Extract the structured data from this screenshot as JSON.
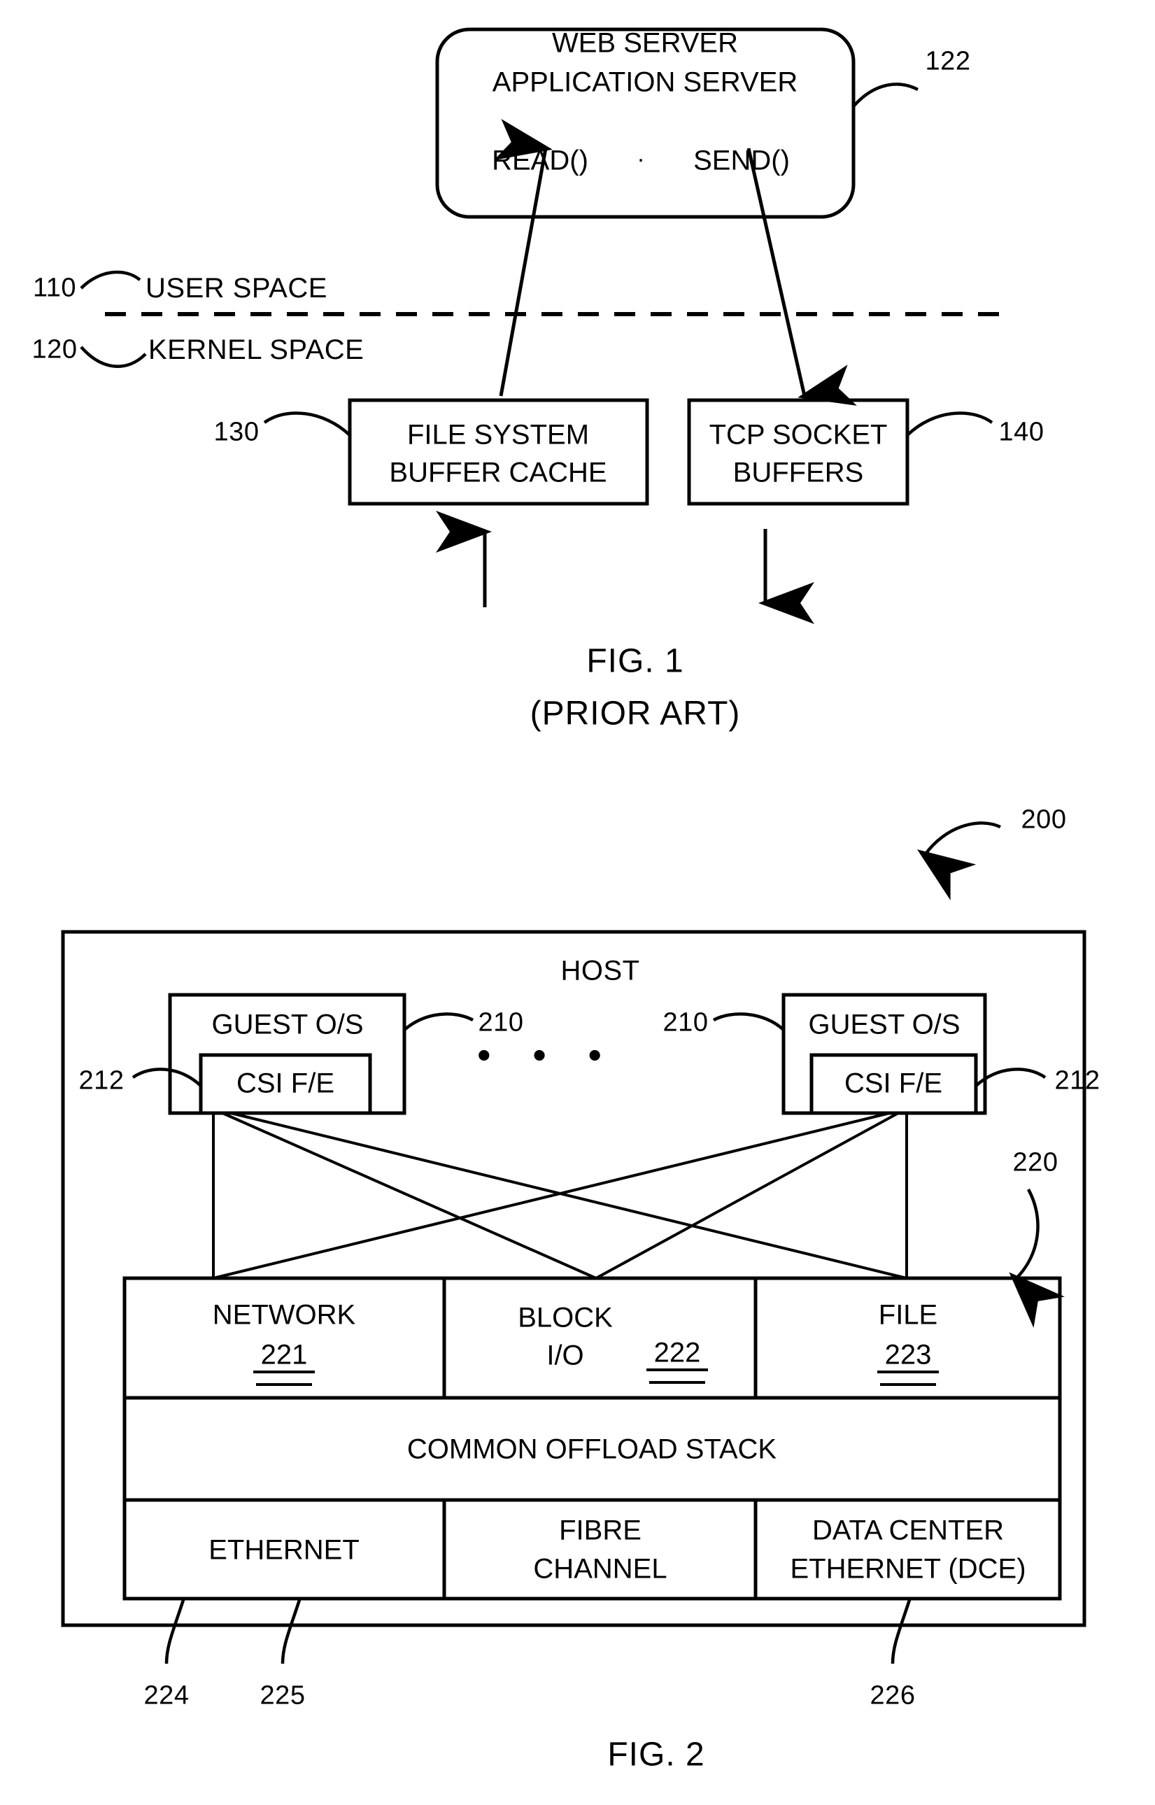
{
  "figures": [
    {
      "id": "fig1",
      "title": "FIG. 1",
      "subtitle": "(PRIOR ART)",
      "nodes": {
        "server_box": {
          "line1": "WEB SERVER",
          "line2": "APPLICATION SERVER",
          "line3_left": "READ()",
          "line3_mid": "·",
          "line3_right": "SEND()",
          "ref": "122"
        },
        "user_space": {
          "label": "USER SPACE",
          "ref": "110"
        },
        "kernel_space": {
          "label": "KERNEL SPACE",
          "ref": "120"
        },
        "file_cache": {
          "line1": "FILE SYSTEM",
          "line2": "BUFFER CACHE",
          "ref": "130"
        },
        "tcp_buffers": {
          "line1": "TCP SOCKET",
          "line2": "BUFFERS",
          "ref": "140"
        }
      }
    },
    {
      "id": "fig2",
      "title": "FIG. 2",
      "ref": "200",
      "host": {
        "label": "HOST"
      },
      "guests": [
        {
          "label": "GUEST O/S",
          "ref": "210",
          "inner_label": "CSI F/E",
          "inner_ref": "212"
        },
        {
          "label": "GUEST O/S",
          "ref": "210",
          "inner_label": "CSI F/E",
          "inner_ref": "212"
        }
      ],
      "ellipsis": "• • •",
      "stack": {
        "ref": "220",
        "top_row": [
          {
            "label": "NETWORK",
            "ref": "221"
          },
          {
            "label_line1": "BLOCK",
            "label_line2": "I/O",
            "ref": "222"
          },
          {
            "label": "FILE",
            "ref": "223"
          }
        ],
        "middle_row": {
          "label": "COMMON OFFLOAD STACK"
        },
        "bottom_row": [
          {
            "label": "ETHERNET",
            "ref": "224"
          },
          {
            "label_line1": "FIBRE",
            "label_line2": "CHANNEL",
            "ref": "225"
          },
          {
            "label_line1": "DATA CENTER",
            "label_line2": "ETHERNET (DCE)",
            "ref": "226"
          }
        ]
      }
    }
  ],
  "colors": {
    "ink": "#000000",
    "paper": "#ffffff"
  }
}
